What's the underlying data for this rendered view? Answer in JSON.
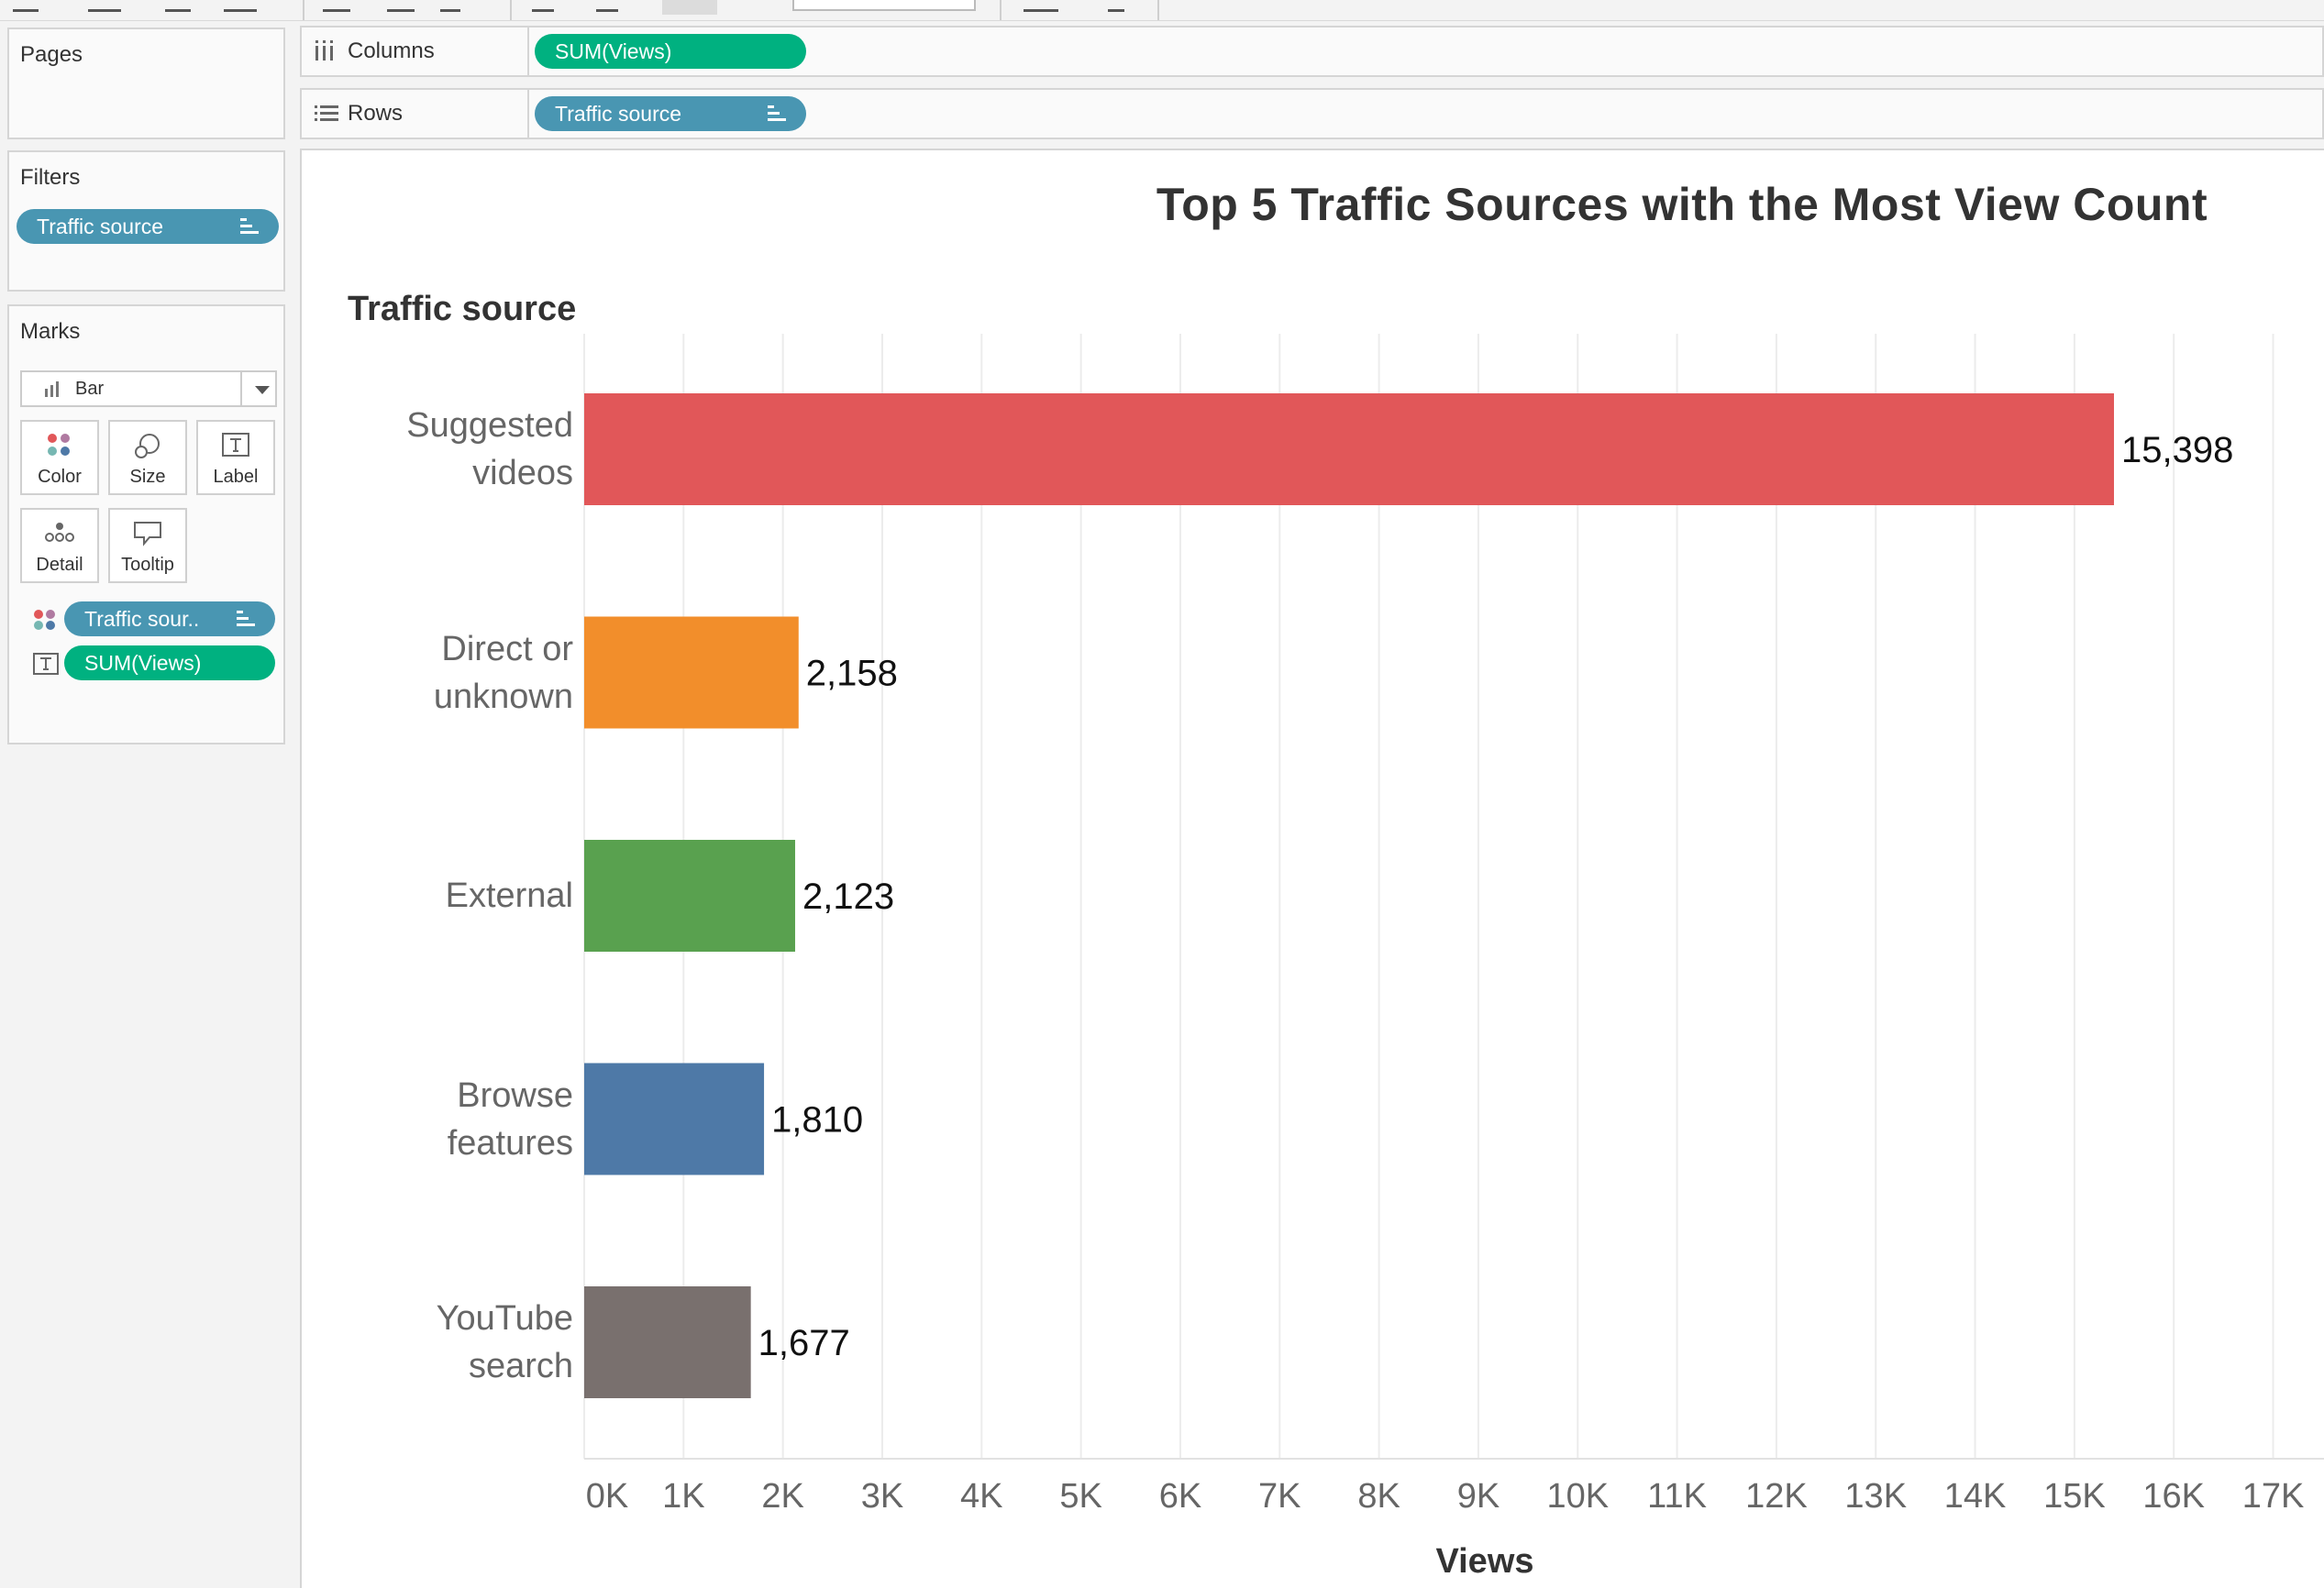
{
  "shelves": {
    "columns_label": "Columns",
    "columns_pill": "SUM(Views)",
    "rows_label": "Rows",
    "rows_pill": "Traffic source"
  },
  "cards": {
    "pages_title": "Pages",
    "filters_title": "Filters",
    "filter_pill": "Traffic source",
    "marks_title": "Marks",
    "mark_type": "Bar",
    "mark_buttons": [
      "Color",
      "Size",
      "Label",
      "Detail",
      "Tooltip"
    ],
    "mark_pills": [
      "Traffic sour..",
      "SUM(Views)"
    ]
  },
  "colors": {
    "accent_blue": "#4996b2",
    "accent_green": "#00b180"
  },
  "chart_data": {
    "type": "bar",
    "title": "Top 5 Traffic Sources with the Most View Count",
    "ylabel": "Traffic source",
    "xlabel": "Views",
    "orientation": "horizontal",
    "categories": [
      "Suggested videos",
      "Direct or unknown",
      "External",
      "Browse features",
      "YouTube search"
    ],
    "category_lines": [
      [
        "Suggested",
        "videos"
      ],
      [
        "Direct or",
        "unknown"
      ],
      [
        "External"
      ],
      [
        "Browse",
        "features"
      ],
      [
        "YouTube",
        "search"
      ]
    ],
    "values": [
      15398,
      2158,
      2123,
      1810,
      1677
    ],
    "value_labels": [
      "15,398",
      "2,158",
      "2,123",
      "1,810",
      "1,677"
    ],
    "colors": [
      "#e15759",
      "#f28e2b",
      "#59a14f",
      "#4e79a7",
      "#79706e"
    ],
    "xlim": [
      0,
      17000
    ],
    "x_ticks": [
      "0K",
      "1K",
      "2K",
      "3K",
      "4K",
      "5K",
      "6K",
      "7K",
      "8K",
      "9K",
      "10K",
      "11K",
      "12K",
      "13K",
      "14K",
      "15K",
      "16K",
      "17K"
    ],
    "grid": true,
    "legend": "none"
  }
}
